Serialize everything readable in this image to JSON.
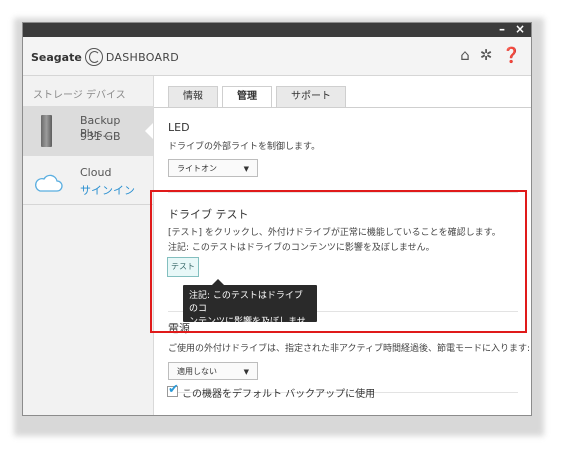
{
  "window": {
    "controls": [
      "–",
      "×"
    ]
  },
  "header": {
    "brand_name": "Seagate",
    "app_name": "DASHBOARD",
    "icons": [
      "home-icon",
      "gear-icon",
      "help-icon"
    ]
  },
  "sidebar": {
    "section_title": "ストレージ デバイス",
    "device": {
      "name": "Backup Plus…",
      "capacity": "931 GB"
    },
    "cloud": {
      "name": "Cloud",
      "link": "サインイン"
    }
  },
  "tabs": [
    "情報",
    "管理",
    "サポート"
  ],
  "led": {
    "title": "LED",
    "description": "ドライブの外部ライトを制御します。",
    "dropdown_value": "ライトオン"
  },
  "drive_test": {
    "title": "ドライブ テスト",
    "line1": "[テスト] をクリックし、外付けドライブが正常に機能していることを確認します。",
    "line2": "注記: このテストはドライブのコンテンツに影響を及ぼしません。",
    "button": "テスト"
  },
  "power": {
    "title": "電源",
    "description": "ご使用の外付けドライブは、指定された非アクティブ時間経過後、節電モードに入ります:",
    "dropdown_value": "適用しない"
  },
  "tooltip": {
    "line1": "注記: このテストはドライブのコ",
    "line2": "ンテンツに影響を及ぼしません。"
  },
  "default_backup": {
    "label": "この機器をデフォルト バックアップに使用",
    "checked": true
  },
  "colors": {
    "highlight": "#e01a1a",
    "link": "#2a8fd0",
    "titlebar": "#3b3b3b"
  }
}
